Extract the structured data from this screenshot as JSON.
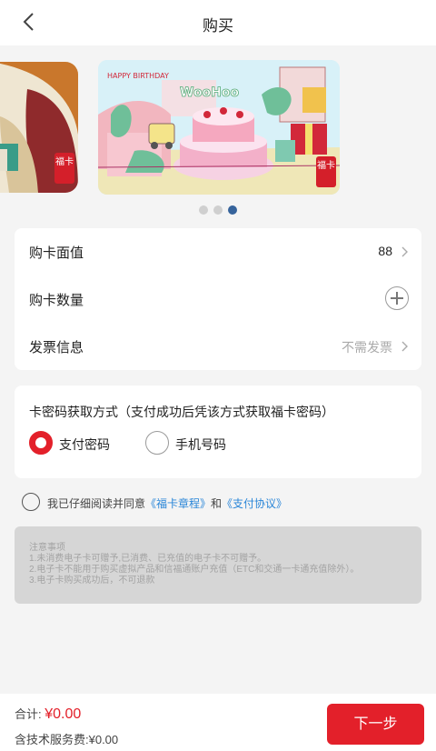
{
  "header": {
    "title": "购买"
  },
  "carousel": {
    "card_text": "HAPPY BIRTHDAY",
    "card_sign": "WooHoo",
    "seal": "福卡",
    "slide_count": 3,
    "active_slide": 3
  },
  "form": {
    "face_value_label": "购卡面值",
    "face_value": "88",
    "quantity_label": "购卡数量",
    "invoice_label": "发票信息",
    "invoice_value": "不需发票"
  },
  "retrieval": {
    "question": "卡密码获取方式（支付成功后凭该方式获取福卡密码）",
    "option_pay_password": "支付密码",
    "option_phone": "手机号码",
    "selected": "支付密码"
  },
  "agreement": {
    "prefix": "我已仔细阅读并同意",
    "link1": "《福卡章程》",
    "and": "和",
    "link2": "《支付协议》"
  },
  "notice": {
    "title": "注意事项",
    "lines": [
      "1.未消费电子卡可赠予,已消费、已充值的电子卡不可赠予。",
      "2.电子卡不能用于购买虚拟产品和信福通账户充值（ETC和交通一卡通充值除外）。",
      "3.电子卡购买成功后，不可退款"
    ]
  },
  "footer": {
    "total_label": "合计: ",
    "total_amount": "¥0.00",
    "fee": "含技术服务费:¥0.00",
    "next_label": "下一步"
  },
  "colors": {
    "accent": "#e3202a",
    "link": "#2a86d8",
    "dot_active": "#36639b"
  }
}
